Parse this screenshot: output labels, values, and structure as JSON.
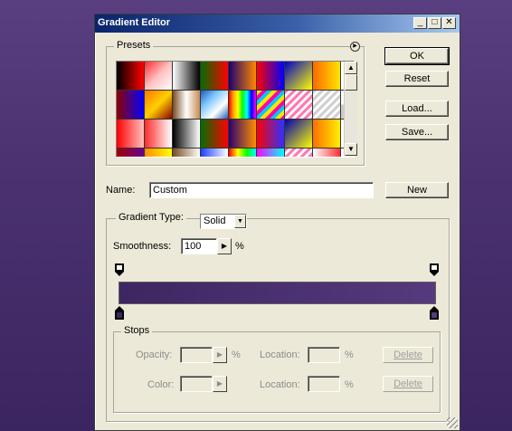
{
  "window": {
    "title": "Gradient Editor",
    "minimize": "_",
    "maximize": "□",
    "close": "✕"
  },
  "presets": {
    "legend": "Presets",
    "menu_icon": "play-circle-icon",
    "swatches": [
      "linear-gradient(90deg,#000,#ff0000)",
      "linear-gradient(135deg,#ff2a2a,#ffc0c0,#fff)",
      "linear-gradient(90deg,#fff,#000)",
      "linear-gradient(90deg,#006e00,#ff0000)",
      "linear-gradient(90deg,#1c0070,#ff8800)",
      "linear-gradient(90deg,#ff0000,#0000ff)",
      "linear-gradient(135deg,#0000c8,#ffff00)",
      "linear-gradient(90deg,#ff6a00,#ffe400)",
      "linear-gradient(90deg,#ffffff,#e8e8e8)",
      "linear-gradient(90deg,#8c0000,#4b0082,#0000ff)",
      "linear-gradient(135deg,#ff7700,#ffd000,#8b0000)",
      "linear-gradient(90deg,#7a4b1f,#fff,#c88c53)",
      "linear-gradient(135deg,#1a5dbc,#7ec7ff,#fff,#1a5dbc)",
      "linear-gradient(90deg,red,orange,yellow,lime,cyan,blue,magenta)",
      "repeating-linear-gradient(135deg,#ffe400 0 4px,#ff00aa 4px 8px,#00c8ff 8px 12px)",
      "repeating-linear-gradient(135deg,#ff7ab3 0 3px,#fff 3px 6px)",
      "repeating-linear-gradient(135deg,#d0d0d0 0 3px,#fff 3px 6px)",
      "conic-gradient(#ccc 25%,#fff 0 50%,#ccc 0 75%,#fff 0)",
      "linear-gradient(90deg,#ff0000,#ffc0c0)",
      "linear-gradient(90deg,#ff2a2a,#fff)",
      "linear-gradient(90deg,#000,#fff)",
      "linear-gradient(90deg,#007000,#ff0000)",
      "linear-gradient(90deg,#2a006e,#ff9000)",
      "linear-gradient(90deg,#ff0000,#3030ff)",
      "linear-gradient(135deg,#0000b0,#ffff00)",
      "linear-gradient(90deg,#ff7000,#ffee00)",
      "linear-gradient(90deg,#fff,#fff)",
      "linear-gradient(90deg,#a00000,#6a0090)",
      "linear-gradient(90deg,#ff8c00,#ffff00)",
      "linear-gradient(90deg,#7a4b1f,#fff)",
      "linear-gradient(90deg,#1c3fff,#ffffff)",
      "linear-gradient(90deg,red,yellow,lime,cyan)",
      "linear-gradient(90deg,#ff00ff,#00ffff)",
      "repeating-linear-gradient(135deg,#ff7ab3 0 3px,#fff 3px 6px)",
      "linear-gradient(90deg,#ffffff,#ff3030)",
      "conic-gradient(#ccc 25%,#fff 0 50%,#ccc 0 75%,#fff 0)"
    ]
  },
  "buttons": {
    "ok": "OK",
    "reset": "Reset",
    "load": "Load...",
    "save": "Save...",
    "new": "New"
  },
  "name": {
    "label": "Name:",
    "value": "Custom"
  },
  "gradient_type": {
    "label": "Gradient Type:",
    "value": "Solid",
    "dropdown_icon": "chevron-down-icon"
  },
  "smoothness": {
    "label": "Smoothness:",
    "value": "100",
    "unit": "%"
  },
  "gradient": {
    "start_color": "#3e2662",
    "end_color": "#553a7d"
  },
  "stops": {
    "legend": "Stops",
    "opacity_label": "Opacity:",
    "opacity_unit": "%",
    "location_label": "Location:",
    "location_unit": "%",
    "color_label": "Color:",
    "delete_label": "Delete"
  }
}
